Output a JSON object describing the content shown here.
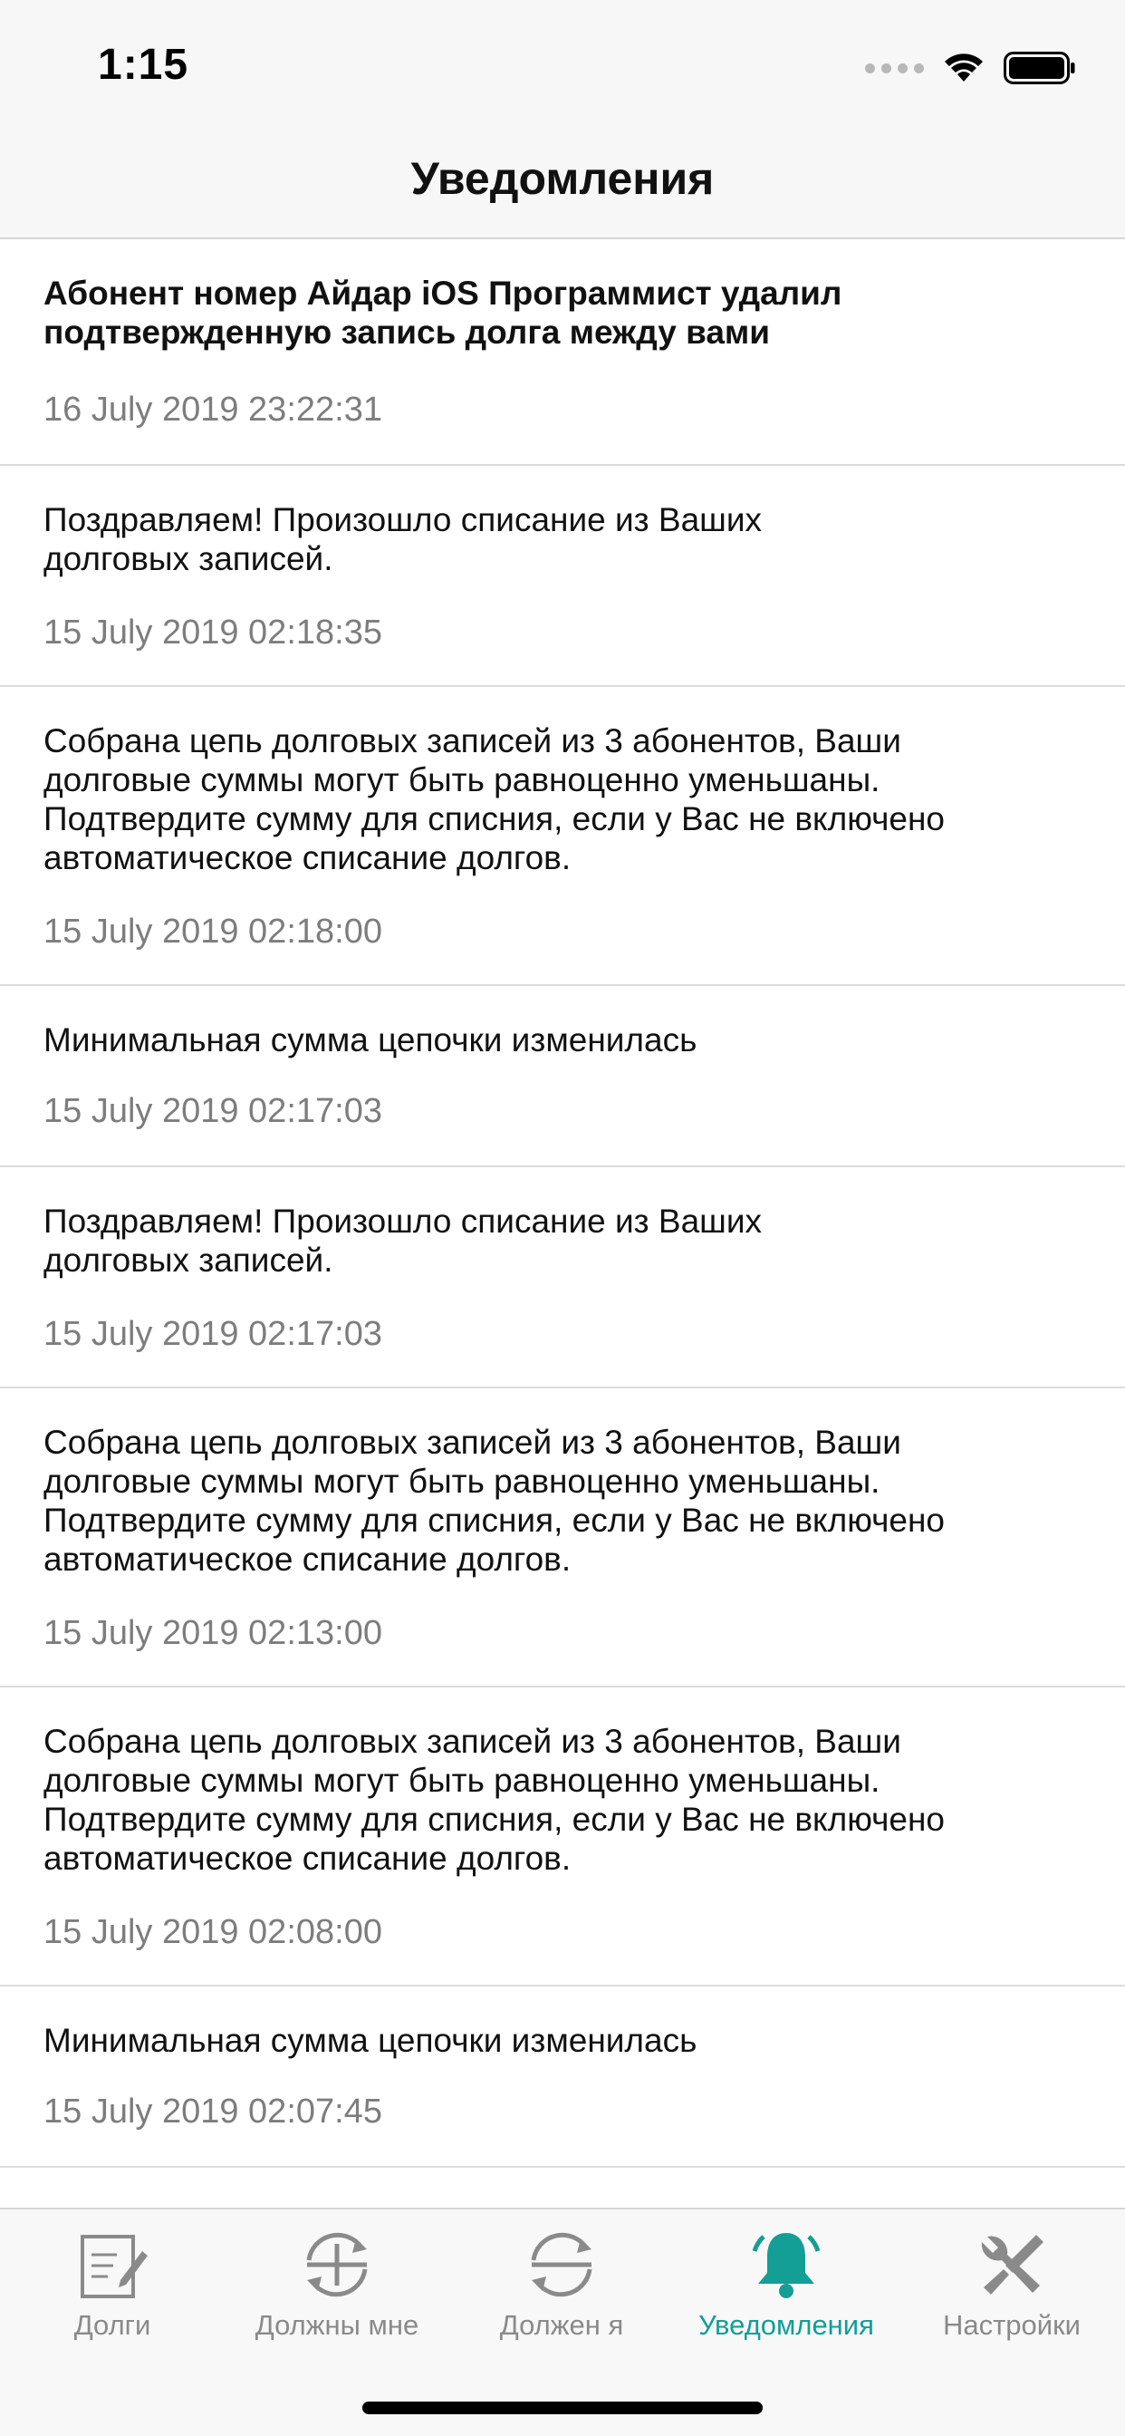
{
  "status_bar": {
    "time": "1:15"
  },
  "nav": {
    "title": "Уведомления"
  },
  "notifications": [
    {
      "text": "Абонент номер  Айдар iOS Программист удалил подтвержденную запись долга между вами",
      "date": "16 July 2019 23:22:31",
      "bold": true
    },
    {
      "text": "Поздравляем! Произошло списание из Ваших долговых записей.",
      "date": "15 July 2019 02:18:35"
    },
    {
      "text": "Собрана цепь долговых записей из 3 абонентов, Ваши долговые суммы могут быть равноценно уменьшаны. Подтвердите сумму для списния, если у Вас не включено автоматическое списание долгов.",
      "date": "15 July 2019 02:18:00"
    },
    {
      "text": "Минимальная сумма цепочки изменилась",
      "date": "15 July 2019 02:17:03"
    },
    {
      "text": "Поздравляем! Произошло списание из Ваших долговых записей.",
      "date": "15 July 2019 02:17:03"
    },
    {
      "text": "Собрана цепь долговых записей из 3 абонентов, Ваши долговые суммы могут быть равноценно уменьшаны. Подтвердите сумму для списния, если у Вас не включено автоматическое списание долгов.",
      "date": "15 July 2019 02:13:00"
    },
    {
      "text": "Собрана цепь долговых записей из 3 абонентов, Ваши долговые суммы могут быть равноценно уменьшаны. Подтвердите сумму для списния, если у Вас не включено автоматическое списание долгов.",
      "date": "15 July 2019 02:08:00"
    },
    {
      "text": "Минимальная сумма цепочки изменилась",
      "date": "15 July 2019 02:07:45"
    }
  ],
  "tabbar": {
    "tabs": [
      {
        "label": "Долги",
        "icon": "document-edit-icon"
      },
      {
        "label": "Должны мне",
        "icon": "plus-refresh-icon"
      },
      {
        "label": "Должен я",
        "icon": "minus-refresh-icon"
      },
      {
        "label": "Уведомления",
        "icon": "bell-icon",
        "active": true
      },
      {
        "label": "Настройки",
        "icon": "wrench-screwdriver-icon"
      }
    ]
  },
  "colors": {
    "accent": "#139e96",
    "inactive": "#8a8a8a",
    "date": "#7d7d7d"
  }
}
